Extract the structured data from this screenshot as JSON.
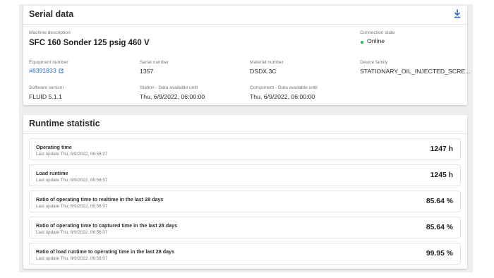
{
  "serial_data": {
    "title": "Serial data",
    "download_icon": "download-icon",
    "machine_description": {
      "label": "Machine description",
      "value": "SFC 160 Sonder 125 psig 460 V"
    },
    "connection_state": {
      "label": "Connection state",
      "value": "Online",
      "status_color": "#22c55e"
    },
    "equipment_number": {
      "label": "Equipment number",
      "value": "#8391833",
      "link_color": "#2f6fc6",
      "icon": "external-link-icon"
    },
    "serial_number": {
      "label": "Serial number",
      "value": "1357"
    },
    "material_number": {
      "label": "Material number",
      "value": "DSDX.3C"
    },
    "device_family": {
      "label": "Device family",
      "value": "STATIONARY_OIL_INJECTED_SCRE..."
    },
    "software_version": {
      "label": "Software version",
      "value": "FLUID 5.1.1"
    },
    "station_data": {
      "label": "Station - Data available until",
      "value": "Thu, 6/9/2022, 06:00:00"
    },
    "component_data": {
      "label": "Component - Data available until",
      "value": "Thu, 6/9/2022, 06:00:00"
    }
  },
  "runtime_statistic": {
    "title": "Runtime statistic",
    "metrics": [
      {
        "label": "Operating time",
        "updated": "Last update Thu, 6/9/2022, 06:56:07",
        "value": "1247 h"
      },
      {
        "label": "Load runtime",
        "updated": "Last update Thu, 6/9/2022, 06:56:07",
        "value": "1245 h"
      },
      {
        "label": "Ratio of operating time to realtime in the last 28 days",
        "updated": "Last update Thu, 6/9/2022, 06:56:07",
        "value": "85.64 %"
      },
      {
        "label": "Ratio of operating time to captured time in the last 28 days",
        "updated": "Last update Thu, 6/9/2022, 06:56:07",
        "value": "85.64 %"
      },
      {
        "label": "Ratio of load runtime to operating time in the last 28 days",
        "updated": "Last update Thu, 6/9/2022, 06:56:07",
        "value": "99.95 %"
      }
    ]
  },
  "theme": {
    "accent": "#2f6fc6",
    "page_background": "#eeeeee",
    "card_background": "#ffffff"
  }
}
